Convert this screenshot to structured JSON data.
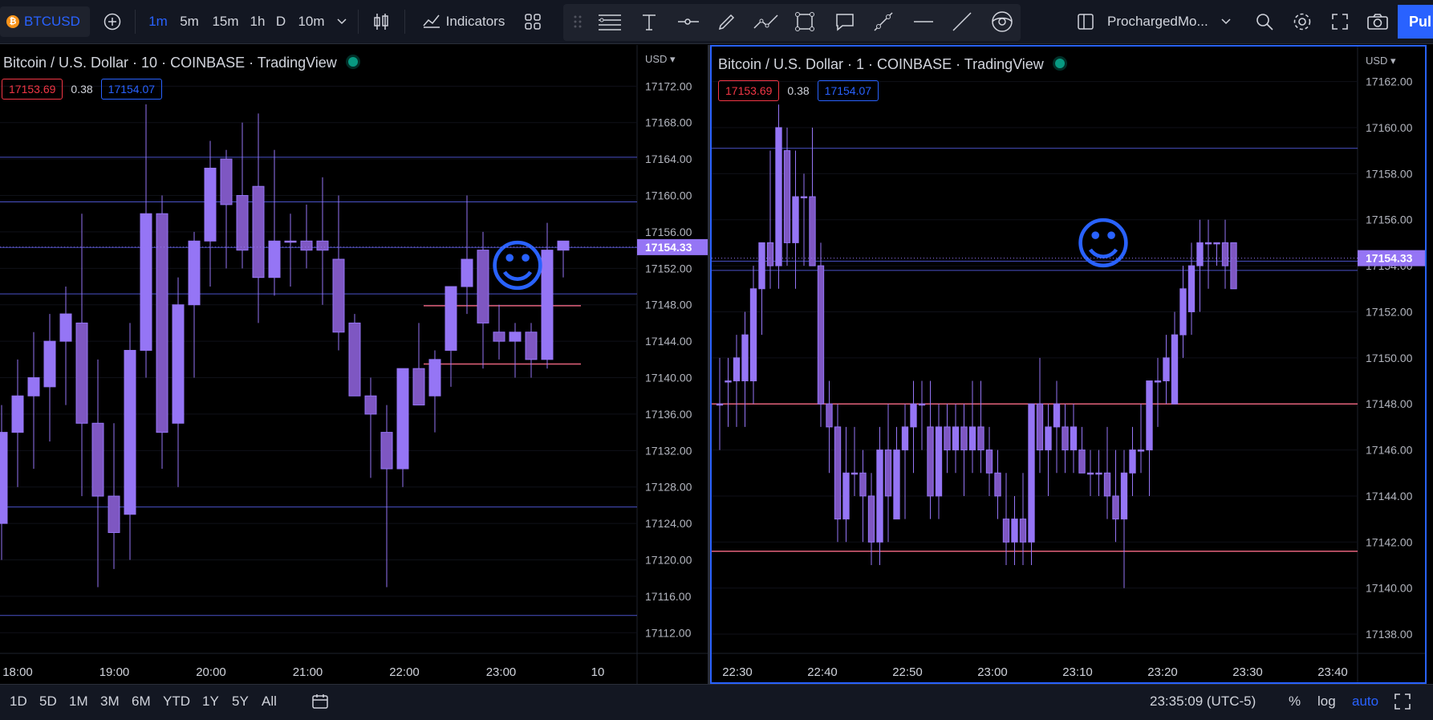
{
  "toolbar": {
    "symbol": "BTCUSD",
    "intervals": [
      "1m",
      "5m",
      "15m",
      "1h",
      "D",
      "10m"
    ],
    "active_interval": "1m",
    "indicators_label": "Indicators",
    "layout_name": "ProchargedMo...",
    "publish_label": "Pul",
    "icons": [
      "bitcoin-icon",
      "add-symbol-icon",
      "chevron-down-icon",
      "bar-type-icon",
      "indicators-icon",
      "templates-icon",
      "drag-handle-icon",
      "lines-icon",
      "text-icon",
      "horizontal-ray-icon",
      "brush-icon",
      "path-icon",
      "rectangle-icon",
      "callout-icon",
      "trend-angle-icon",
      "horizontal-line-icon",
      "trend-line-icon",
      "hide-drawings-icon",
      "layout-icon",
      "chevron-down-icon",
      "search-icon",
      "settings-icon",
      "fullscreen-icon",
      "snapshot-icon"
    ]
  },
  "left_chart": {
    "title": "Bitcoin / U.S. Dollar · 10 · COINBASE · TradingView",
    "bid": "17153.69",
    "spread": "0.38",
    "ask": "17154.07",
    "currency": "USD",
    "last_price_label": "17154.33",
    "price_ticks": [
      "17172.00",
      "17168.00",
      "17164.00",
      "17160.00",
      "17156.00",
      "17152.00",
      "17148.00",
      "17144.00",
      "17140.00",
      "17136.00",
      "17132.00",
      "17128.00",
      "17124.00",
      "17120.00",
      "17116.00",
      "17112.00"
    ],
    "time_ticks": [
      "18:00",
      "19:00",
      "20:00",
      "21:00",
      "22:00",
      "23:00",
      "10"
    ]
  },
  "right_chart": {
    "title": "Bitcoin / U.S. Dollar · 1 · COINBASE · TradingView",
    "bid": "17153.69",
    "spread": "0.38",
    "ask": "17154.07",
    "currency": "USD",
    "last_price_label": "17154.33",
    "price_ticks": [
      "17162.00",
      "17160.00",
      "17158.00",
      "17156.00",
      "17154.00",
      "17152.00",
      "17150.00",
      "17148.00",
      "17146.00",
      "17144.00",
      "17142.00",
      "17140.00",
      "17138.00"
    ],
    "time_ticks": [
      "22:30",
      "22:40",
      "22:50",
      "23:00",
      "23:10",
      "23:20",
      "23:30",
      "23:40"
    ]
  },
  "bottombar": {
    "ranges": [
      "1D",
      "5D",
      "1M",
      "3M",
      "6M",
      "YTD",
      "1Y",
      "5Y",
      "All"
    ],
    "clock": "23:35:09 (UTC-5)",
    "percent_label": "%",
    "log_label": "log",
    "auto_label": "auto",
    "icons": [
      "date-range-icon",
      "fullscreen-icon"
    ]
  },
  "chart_data": [
    {
      "type": "candlestick",
      "symbol": "BTCUSD",
      "interval": "10",
      "ylim": [
        17110,
        17173
      ],
      "candle_color": "#9575f5",
      "last_price": 17154.33,
      "drawings": {
        "hlines": [
          17164.2,
          17159.3,
          17154.3,
          17149.2,
          17125.8,
          17113.9
        ],
        "hlines_red": [
          17147.9,
          17141.5
        ],
        "emoji": "☺"
      },
      "candles": [
        {
          "o": 17124,
          "h": 17137,
          "l": 17120,
          "c": 17134
        },
        {
          "o": 17134,
          "h": 17142,
          "l": 17128,
          "c": 17138
        },
        {
          "o": 17138,
          "h": 17145,
          "l": 17130,
          "c": 17140
        },
        {
          "o": 17139,
          "h": 17147,
          "l": 17133,
          "c": 17144
        },
        {
          "o": 17144,
          "h": 17150,
          "l": 17137,
          "c": 17147
        },
        {
          "o": 17146,
          "h": 17158,
          "l": 17127,
          "c": 17135
        },
        {
          "o": 17135,
          "h": 17142,
          "l": 17117,
          "c": 17127
        },
        {
          "o": 17127,
          "h": 17135,
          "l": 17119,
          "c": 17123
        },
        {
          "o": 17125,
          "h": 17146,
          "l": 17120,
          "c": 17143
        },
        {
          "o": 17143,
          "h": 17170,
          "l": 17140,
          "c": 17158
        },
        {
          "o": 17158,
          "h": 17160,
          "l": 17130,
          "c": 17134
        },
        {
          "o": 17135,
          "h": 17151,
          "l": 17128,
          "c": 17148
        },
        {
          "o": 17148,
          "h": 17156,
          "l": 17140,
          "c": 17155
        },
        {
          "o": 17155,
          "h": 17166,
          "l": 17150,
          "c": 17163
        },
        {
          "o": 17164,
          "h": 17165,
          "l": 17152,
          "c": 17159
        },
        {
          "o": 17160,
          "h": 17168,
          "l": 17152,
          "c": 17154
        },
        {
          "o": 17161,
          "h": 17169,
          "l": 17146,
          "c": 17151
        },
        {
          "o": 17151,
          "h": 17165,
          "l": 17149,
          "c": 17155
        },
        {
          "o": 17155,
          "h": 17158,
          "l": 17150,
          "c": 17155
        },
        {
          "o": 17155,
          "h": 17159,
          "l": 17152,
          "c": 17154
        },
        {
          "o": 17155,
          "h": 17162,
          "l": 17148,
          "c": 17154
        },
        {
          "o": 17153,
          "h": 17160,
          "l": 17143,
          "c": 17145
        },
        {
          "o": 17146,
          "h": 17147,
          "l": 17138,
          "c": 17138
        },
        {
          "o": 17138,
          "h": 17140,
          "l": 17129,
          "c": 17136
        },
        {
          "o": 17134,
          "h": 17137,
          "l": 17117,
          "c": 17130
        },
        {
          "o": 17130,
          "h": 17141,
          "l": 17128,
          "c": 17141
        },
        {
          "o": 17141,
          "h": 17146,
          "l": 17137,
          "c": 17137
        },
        {
          "o": 17138,
          "h": 17143,
          "l": 17134,
          "c": 17142
        },
        {
          "o": 17143,
          "h": 17147,
          "l": 17139,
          "c": 17150
        },
        {
          "o": 17150,
          "h": 17160,
          "l": 17147,
          "c": 17153
        },
        {
          "o": 17154,
          "h": 17156,
          "l": 17141,
          "c": 17146
        },
        {
          "o": 17145,
          "h": 17148,
          "l": 17142,
          "c": 17144
        },
        {
          "o": 17144,
          "h": 17146,
          "l": 17140,
          "c": 17145
        },
        {
          "o": 17145,
          "h": 17146,
          "l": 17140,
          "c": 17142
        },
        {
          "o": 17142,
          "h": 17157,
          "l": 17141,
          "c": 17154
        },
        {
          "o": 17154,
          "h": 17155,
          "l": 17151,
          "c": 17155
        }
      ]
    },
    {
      "type": "candlestick",
      "symbol": "BTCUSD",
      "interval": "1",
      "ylim": [
        17137.2,
        17162.3
      ],
      "candle_color": "#9575f5",
      "last_price": 17154.33,
      "drawings": {
        "hlines": [
          17159.1,
          17154.2,
          17153.8
        ],
        "hlines_red": [
          17148.0,
          17141.6
        ],
        "emoji": "☺"
      },
      "candles": [
        {
          "o": 17148,
          "h": 17150,
          "l": 17146,
          "c": 17148
        },
        {
          "o": 17149,
          "h": 17150,
          "l": 17147,
          "c": 17149
        },
        {
          "o": 17149,
          "h": 17151,
          "l": 17147,
          "c": 17150
        },
        {
          "o": 17149,
          "h": 17152,
          "l": 17147,
          "c": 17151
        },
        {
          "o": 17149,
          "h": 17154,
          "l": 17148,
          "c": 17153
        },
        {
          "o": 17153,
          "h": 17155,
          "l": 17151,
          "c": 17155
        },
        {
          "o": 17155,
          "h": 17159,
          "l": 17153,
          "c": 17154
        },
        {
          "o": 17154,
          "h": 17161,
          "l": 17153,
          "c": 17160
        },
        {
          "o": 17159,
          "h": 17160,
          "l": 17154,
          "c": 17155
        },
        {
          "o": 17155,
          "h": 17159,
          "l": 17153,
          "c": 17157
        },
        {
          "o": 17157,
          "h": 17158,
          "l": 17154,
          "c": 17157
        },
        {
          "o": 17157,
          "h": 17160,
          "l": 17154,
          "c": 17154
        },
        {
          "o": 17154,
          "h": 17155,
          "l": 17147,
          "c": 17148
        },
        {
          "o": 17148,
          "h": 17149,
          "l": 17145,
          "c": 17147
        },
        {
          "o": 17147,
          "h": 17148,
          "l": 17142,
          "c": 17143
        },
        {
          "o": 17143,
          "h": 17147,
          "l": 17142,
          "c": 17145
        },
        {
          "o": 17145,
          "h": 17147,
          "l": 17144,
          "c": 17145
        },
        {
          "o": 17145,
          "h": 17146,
          "l": 17142,
          "c": 17144
        },
        {
          "o": 17144,
          "h": 17145,
          "l": 17141,
          "c": 17142
        },
        {
          "o": 17142,
          "h": 17147,
          "l": 17141,
          "c": 17146
        },
        {
          "o": 17146,
          "h": 17148,
          "l": 17142,
          "c": 17144
        },
        {
          "o": 17143,
          "h": 17147,
          "l": 17143,
          "c": 17146
        },
        {
          "o": 17146,
          "h": 17148,
          "l": 17143,
          "c": 17147
        },
        {
          "o": 17147,
          "h": 17149,
          "l": 17145,
          "c": 17148
        },
        {
          "o": 17148,
          "h": 17149,
          "l": 17146,
          "c": 17148
        },
        {
          "o": 17147,
          "h": 17149,
          "l": 17143,
          "c": 17144
        },
        {
          "o": 17144,
          "h": 17148,
          "l": 17143,
          "c": 17147
        },
        {
          "o": 17147,
          "h": 17148,
          "l": 17145,
          "c": 17146
        },
        {
          "o": 17146,
          "h": 17148,
          "l": 17145,
          "c": 17147
        },
        {
          "o": 17147,
          "h": 17148,
          "l": 17144,
          "c": 17146
        },
        {
          "o": 17146,
          "h": 17149,
          "l": 17145,
          "c": 17147
        },
        {
          "o": 17147,
          "h": 17149,
          "l": 17145,
          "c": 17146
        },
        {
          "o": 17146,
          "h": 17147,
          "l": 17144,
          "c": 17145
        },
        {
          "o": 17145,
          "h": 17146,
          "l": 17143,
          "c": 17144
        },
        {
          "o": 17143,
          "h": 17145,
          "l": 17141,
          "c": 17142
        },
        {
          "o": 17142,
          "h": 17144,
          "l": 17141,
          "c": 17143
        },
        {
          "o": 17143,
          "h": 17145,
          "l": 17141,
          "c": 17142
        },
        {
          "o": 17142,
          "h": 17148,
          "l": 17141,
          "c": 17148
        },
        {
          "o": 17148,
          "h": 17150,
          "l": 17145,
          "c": 17146
        },
        {
          "o": 17146,
          "h": 17148,
          "l": 17144,
          "c": 17147
        },
        {
          "o": 17147,
          "h": 17149,
          "l": 17145,
          "c": 17148
        },
        {
          "o": 17147,
          "h": 17148,
          "l": 17145,
          "c": 17146
        },
        {
          "o": 17146,
          "h": 17148,
          "l": 17145,
          "c": 17147
        },
        {
          "o": 17146,
          "h": 17147,
          "l": 17145,
          "c": 17145
        },
        {
          "o": 17145,
          "h": 17146,
          "l": 17144,
          "c": 17145
        },
        {
          "o": 17145,
          "h": 17146,
          "l": 17144,
          "c": 17145
        },
        {
          "o": 17145,
          "h": 17147,
          "l": 17143,
          "c": 17144
        },
        {
          "o": 17144,
          "h": 17146,
          "l": 17142,
          "c": 17143
        },
        {
          "o": 17143,
          "h": 17146,
          "l": 17140,
          "c": 17145
        },
        {
          "o": 17145,
          "h": 17147,
          "l": 17144,
          "c": 17146
        },
        {
          "o": 17146,
          "h": 17148,
          "l": 17145,
          "c": 17146
        },
        {
          "o": 17146,
          "h": 17149,
          "l": 17144,
          "c": 17149
        },
        {
          "o": 17149,
          "h": 17150,
          "l": 17147,
          "c": 17149
        },
        {
          "o": 17149,
          "h": 17151,
          "l": 17148,
          "c": 17150
        },
        {
          "o": 17148,
          "h": 17152,
          "l": 17148,
          "c": 17151
        },
        {
          "o": 17151,
          "h": 17154,
          "l": 17150,
          "c": 17153
        },
        {
          "o": 17152,
          "h": 17155,
          "l": 17151,
          "c": 17154
        },
        {
          "o": 17154,
          "h": 17156,
          "l": 17152,
          "c": 17155
        },
        {
          "o": 17155,
          "h": 17156,
          "l": 17153,
          "c": 17155
        },
        {
          "o": 17155,
          "h": 17155,
          "l": 17154,
          "c": 17155
        },
        {
          "o": 17155,
          "h": 17156,
          "l": 17153,
          "c": 17154
        },
        {
          "o": 17155,
          "h": 17155,
          "l": 17153,
          "c": 17153
        }
      ]
    }
  ]
}
